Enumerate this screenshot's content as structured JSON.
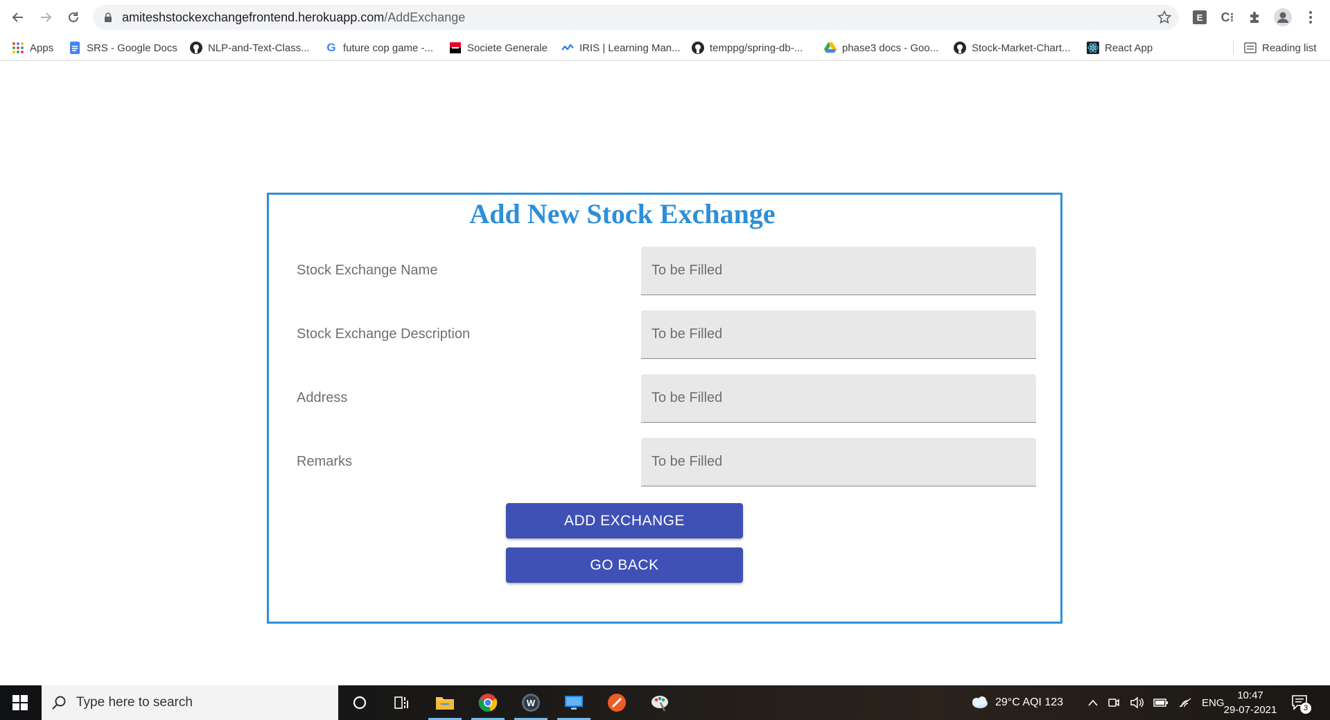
{
  "browser": {
    "url_host": "amiteshstockexchangefrontend.herokuapp.com",
    "url_path": "/AddExchange",
    "extensions": [
      "E",
      "C⁝"
    ],
    "bookmarks": [
      {
        "label": "Apps",
        "icon": "apps-grid-icon"
      },
      {
        "label": "SRS - Google Docs",
        "icon": "google-docs-icon"
      },
      {
        "label": "NLP-and-Text-Class...",
        "icon": "github-icon"
      },
      {
        "label": "future cop game -...",
        "icon": "google-icon"
      },
      {
        "label": "Societe Generale",
        "icon": "societe-generale-icon"
      },
      {
        "label": "IRIS | Learning Man...",
        "icon": "iris-icon"
      },
      {
        "label": "temppg/spring-db-...",
        "icon": "github-icon"
      },
      {
        "label": "phase3 docs - Goo...",
        "icon": "google-drive-icon"
      },
      {
        "label": "Stock-Market-Chart...",
        "icon": "github-icon"
      },
      {
        "label": "React App",
        "icon": "react-icon"
      }
    ],
    "reading_list": "Reading list"
  },
  "page": {
    "title": "Add New Stock Exchange",
    "fields": [
      {
        "label": "Stock Exchange Name",
        "placeholder": "To be Filled"
      },
      {
        "label": "Stock Exchange Description",
        "placeholder": "To be Filled"
      },
      {
        "label": "Address",
        "placeholder": "To be Filled"
      },
      {
        "label": "Remarks",
        "placeholder": "To be Filled"
      }
    ],
    "add_button": "ADD EXCHANGE",
    "back_button": "GO BACK"
  },
  "taskbar": {
    "search_placeholder": "Type here to search",
    "weather": "29°C  AQI 123",
    "language": "ENG",
    "time": "10:47",
    "date": "29-07-2021",
    "notifications": "3"
  },
  "colors": {
    "accent": "#2e8fd8",
    "button": "#3f51b5",
    "field_bg": "#e8e8e8"
  }
}
